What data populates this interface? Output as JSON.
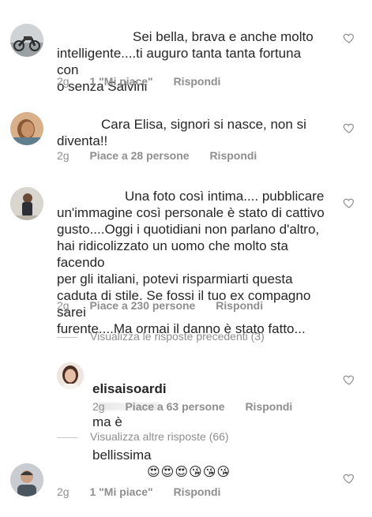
{
  "comments": [
    {
      "text": "Sei bella, brava e anche molto\nintelligente....ti auguro tanta tanta fortuna con\no senza Salvini",
      "time": "2g",
      "likes": "1 \"Mi piace\"",
      "reply": "Rispondi"
    },
    {
      "text": "Cara Elisa, signori si nasce, non si\ndiventa!!",
      "time": "2g",
      "likes": "Piace a 28 persone",
      "reply": "Rispondi"
    },
    {
      "text": "Una foto così intima.... pubblicare\nun'immagine così personale è  stato di cattivo\ngusto....Oggi i quotidiani non parlano d'altro,\nhai ridicolizzato un uomo che molto sta facendo\nper gli italiani, potevi risparmiarti  questa\ncaduta di stile. Se fossi il tuo ex compagno sarei\nfurente....Ma ormai il danno è  stato fatto...",
      "time": "2g",
      "likes": "Piace a 230 persone",
      "reply": "Rispondi"
    },
    {
      "emojis": "😍😍😍😘😘😘",
      "time": "2g",
      "likes": "1 \"Mi piace\"",
      "reply": "Rispondi"
    }
  ],
  "view_previous": "Visualizza le risposte precedenti (3)",
  "reply": {
    "username": "elisaisoardi",
    "text_a": "ma è",
    "text_b": "bellissima",
    "time": "2g",
    "likes": "Piace a 63 persone",
    "reply": "Rispondi"
  },
  "view_more": "Visualizza altre risposte (66)",
  "colors": {
    "meta": "#8e8e8e",
    "text": "#262626",
    "heart": "#8e8e8e"
  },
  "icons": {
    "like": "heart-outline-icon"
  }
}
